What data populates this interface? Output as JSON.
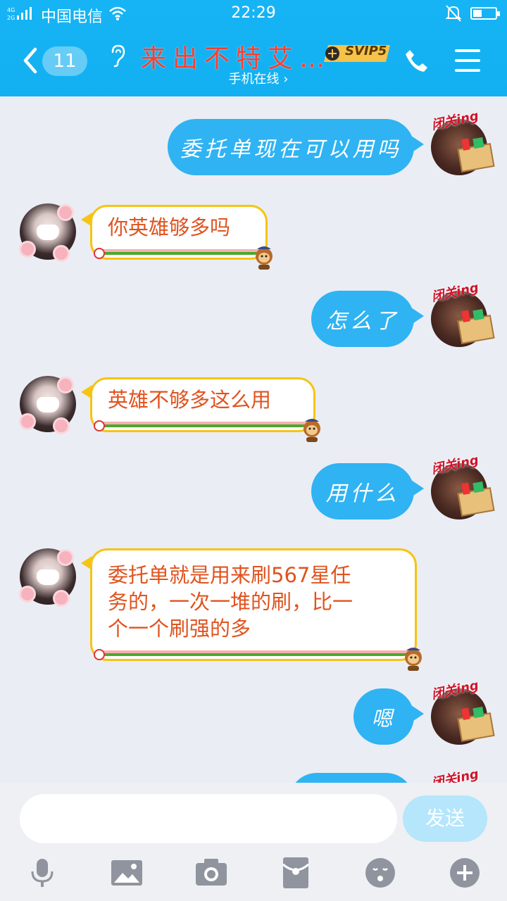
{
  "status_bar": {
    "network": "4G 2G",
    "carrier": "中国电信",
    "time": "22:29",
    "battery_percent": 40
  },
  "header": {
    "unread_count": "11",
    "contact_name": "来出不特艾…",
    "vip_badge": "SVIP5",
    "online_status": "手机在线 ›"
  },
  "avatar_tag": "闭关ing",
  "messages": [
    {
      "side": "self",
      "text": "委托单现在可以用吗"
    },
    {
      "side": "other",
      "text": "你英雄够多吗"
    },
    {
      "side": "self",
      "text": "怎么了"
    },
    {
      "side": "other",
      "text": "英雄不够多这么用"
    },
    {
      "side": "self",
      "text": "用什么"
    },
    {
      "side": "other",
      "lines": [
        "委托单就是用来刷567星任",
        "务的，一次一堆的刷，比一",
        "个一个刷强的多"
      ]
    },
    {
      "side": "self",
      "text": "嗯"
    }
  ],
  "input": {
    "value": "",
    "send_label": "发送"
  },
  "toolbar_icons": [
    "microphone-icon",
    "picture-icon",
    "camera-icon",
    "red-packet-icon",
    "emoji-icon",
    "plus-icon"
  ],
  "colors": {
    "header_bg": "#16b4f5",
    "self_bubble": "#2fb3f3",
    "other_text": "#e0531e",
    "other_border": "#f6c413",
    "name_color": "#ff3d2e"
  }
}
